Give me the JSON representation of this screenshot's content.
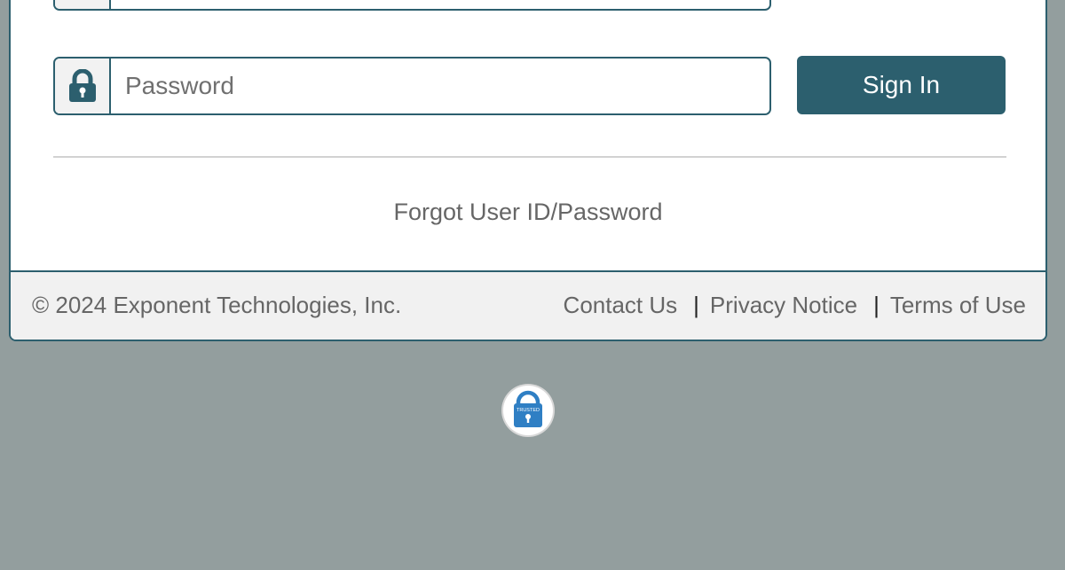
{
  "login": {
    "password_placeholder": "Password",
    "sign_in_label": "Sign In",
    "forgot_label": "Forgot User ID/Password"
  },
  "footer": {
    "copyright": "© 2024 Exponent Technologies, Inc.",
    "links": [
      "Contact Us",
      "Privacy Notice",
      "Terms of Use"
    ],
    "separator": "|"
  },
  "badge": {
    "text": "TRUSTED"
  },
  "colors": {
    "accent": "#2c5f6e",
    "background": "#939e9e",
    "badge_blue": "#2f7fc4"
  },
  "icons": {
    "password_addon": "lock-icon",
    "badge": "padlock-icon"
  }
}
